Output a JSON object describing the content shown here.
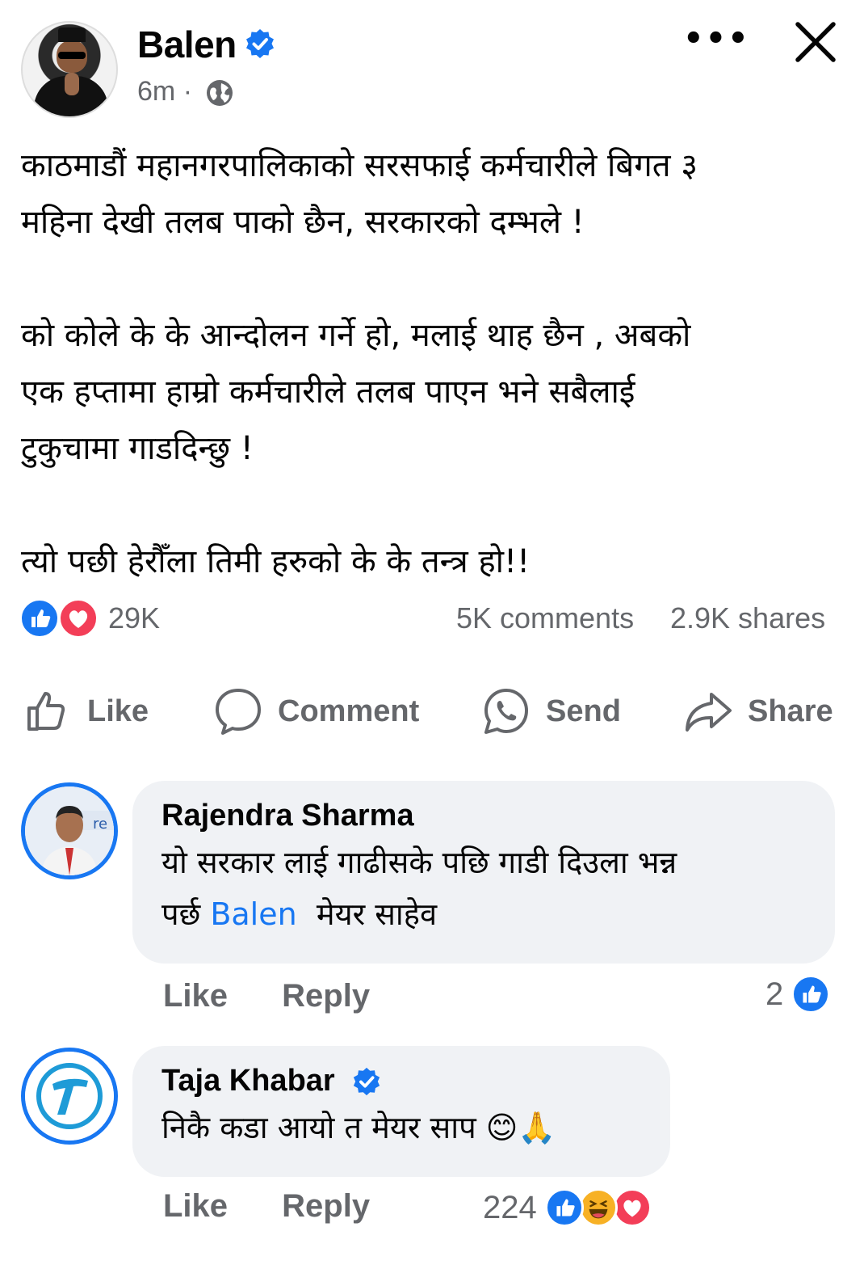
{
  "post": {
    "author": "Balen",
    "time": "6m",
    "separator": "·",
    "more_label": "•••",
    "paragraphs": [
      "काठमाडौं महानगरपालिकाको सरसफाई कर्मचारीले बिगत ३\nमहिना देखी तलब पाको छैन, सरकारको दम्भले !",
      "को कोले के के आन्दोलन गर्ने हो, मलाई थाह छैन , अबको\nएक हप्तामा हाम्रो कर्मचारीले तलब पाएन भने सबैलाई\nटुकुचामा गाडदिन्छु !",
      "त्यो पछी हेरौँला तिमी हरुको के के तन्त्र हो!!"
    ]
  },
  "stats": {
    "reactions": "29K",
    "comments": "5K comments",
    "shares": "2.9K shares"
  },
  "actions": {
    "like": "Like",
    "comment": "Comment",
    "send": "Send",
    "share": "Share"
  },
  "comments": [
    {
      "name": "Rajendra Sharma",
      "text_before": "यो सरकार लाई गाढीसके पछि गाडी दिउला भन्न\nपर्छ ",
      "mention": "Balen",
      "text_after": "  मेयर साहेव",
      "like_label": "Like",
      "reply_label": "Reply",
      "reaction_count": "2"
    },
    {
      "name": "Taja Khabar",
      "text": "निकै कडा आयो त मेयर साप 😊🙏",
      "like_label": "Like",
      "reply_label": "Reply",
      "reaction_count": "224"
    }
  ],
  "colors": {
    "brand_blue": "#1877f2",
    "love_red": "#f33e58",
    "haha_yellow": "#f7b125",
    "muted_text": "#65676b",
    "bubble_bg": "#f0f2f5"
  },
  "icons": [
    "verified-badge-icon",
    "globe-icon",
    "more-icon",
    "close-icon",
    "like-reaction-icon",
    "love-reaction-icon",
    "haha-reaction-icon",
    "thumbs-up-icon",
    "comment-icon",
    "whatsapp-send-icon",
    "share-arrow-icon"
  ]
}
